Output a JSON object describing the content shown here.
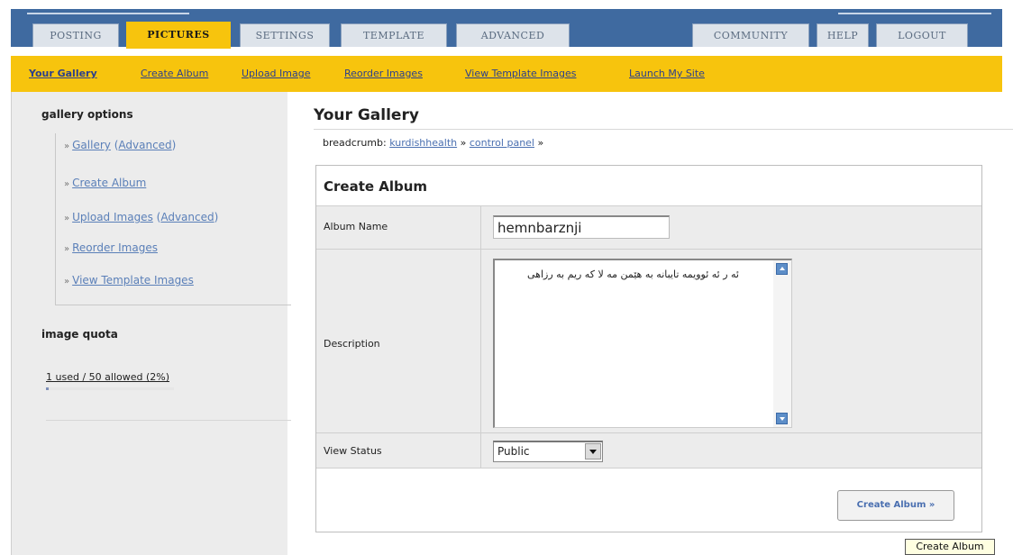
{
  "top_nav": {
    "tabs": [
      {
        "label": "POSTING"
      },
      {
        "label": "PICTURES"
      },
      {
        "label": "SETTINGS"
      },
      {
        "label": "TEMPLATE"
      },
      {
        "label": "ADVANCED"
      },
      {
        "label": "COMMUNITY"
      },
      {
        "label": "HELP"
      },
      {
        "label": "LOGOUT"
      }
    ],
    "active_tab": "PICTURES"
  },
  "sub_nav": {
    "links": [
      {
        "label": "Your Gallery"
      },
      {
        "label": "Create Album"
      },
      {
        "label": "Upload Image"
      },
      {
        "label": "Reorder Images"
      },
      {
        "label": "View Template Images"
      },
      {
        "label": "Launch My Site"
      }
    ]
  },
  "sidebar": {
    "options_heading": "gallery options",
    "options": [
      {
        "label": "Gallery",
        "extra": "Advanced"
      },
      {
        "label": "Create Album"
      },
      {
        "label": "Upload Images",
        "extra": "Advanced"
      },
      {
        "label": "Reorder Images"
      },
      {
        "label": "View Template Images"
      }
    ],
    "bullet": "»",
    "quota_heading": "image quota",
    "quota_text": "1 used / 50 allowed (2%)",
    "quota_used_fraction": 0.02
  },
  "main": {
    "title": "Your Gallery",
    "breadcrumb": {
      "prefix": "breadcrumb:",
      "links": [
        "kurdishhealth",
        "control panel"
      ],
      "separator": "»"
    },
    "form": {
      "title": "Create Album",
      "album_name_label": "Album Name",
      "album_name_value": "hemnbarznji",
      "description_label": "Description",
      "description_value": "ئه ر ئه ئوویمه تایبانه به هێمن مه لا که ریم به رزاهی",
      "view_status_label": "View Status",
      "view_status_value": "Public",
      "submit_label": "Create Album »"
    },
    "tooltip": "Create Album"
  },
  "colors": {
    "nav_blue": "#3f6aa0",
    "accent_yellow": "#f7c40d",
    "link_blue": "#4a6fb0"
  }
}
